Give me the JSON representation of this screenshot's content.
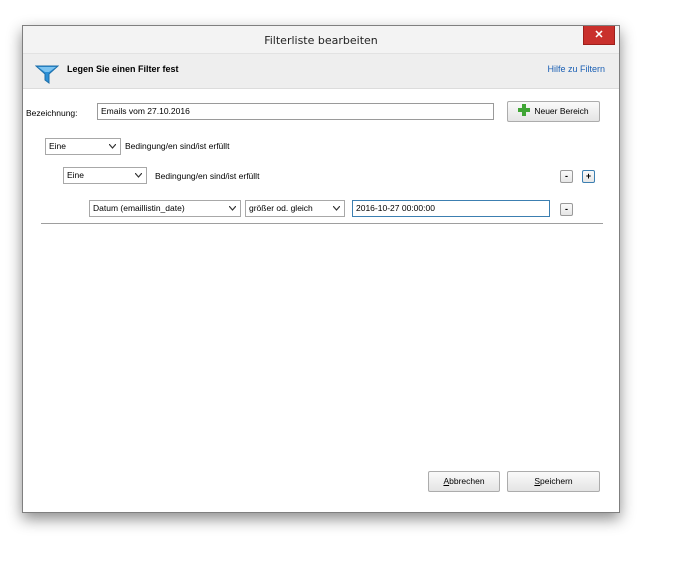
{
  "window": {
    "title": "Filterliste bearbeiten",
    "close_glyph": "✕"
  },
  "header": {
    "title": "Legen Sie einen Filter fest",
    "help_link": "Hilfe zu Filtern",
    "icon": "funnel-icon"
  },
  "name_row": {
    "label": "Bezeichnung:",
    "value": "Emails vom 27.10.2016",
    "new_area_button": "Neuer Bereich"
  },
  "group_outer": {
    "mode": "Eine",
    "text": "Bedingung/en sind/ist erfüllt"
  },
  "group_inner": {
    "mode": "Eine",
    "text": "Bedingung/en sind/ist erfüllt",
    "remove_label": "-",
    "add_label": "+"
  },
  "condition": {
    "field": "Datum (emaillistin_date)",
    "operator": "größer od. gleich",
    "value": "2016-10-27 00:00:00",
    "remove_label": "-"
  },
  "footer": {
    "cancel_mnemonic": "A",
    "cancel_rest": "bbrechen",
    "save_mnemonic": "S",
    "save_rest": "peichern"
  },
  "colors": {
    "close_red": "#c9302c",
    "link_blue": "#1a5fb4",
    "funnel_blue": "#2b8fd6",
    "plus_green": "#3fa535"
  }
}
